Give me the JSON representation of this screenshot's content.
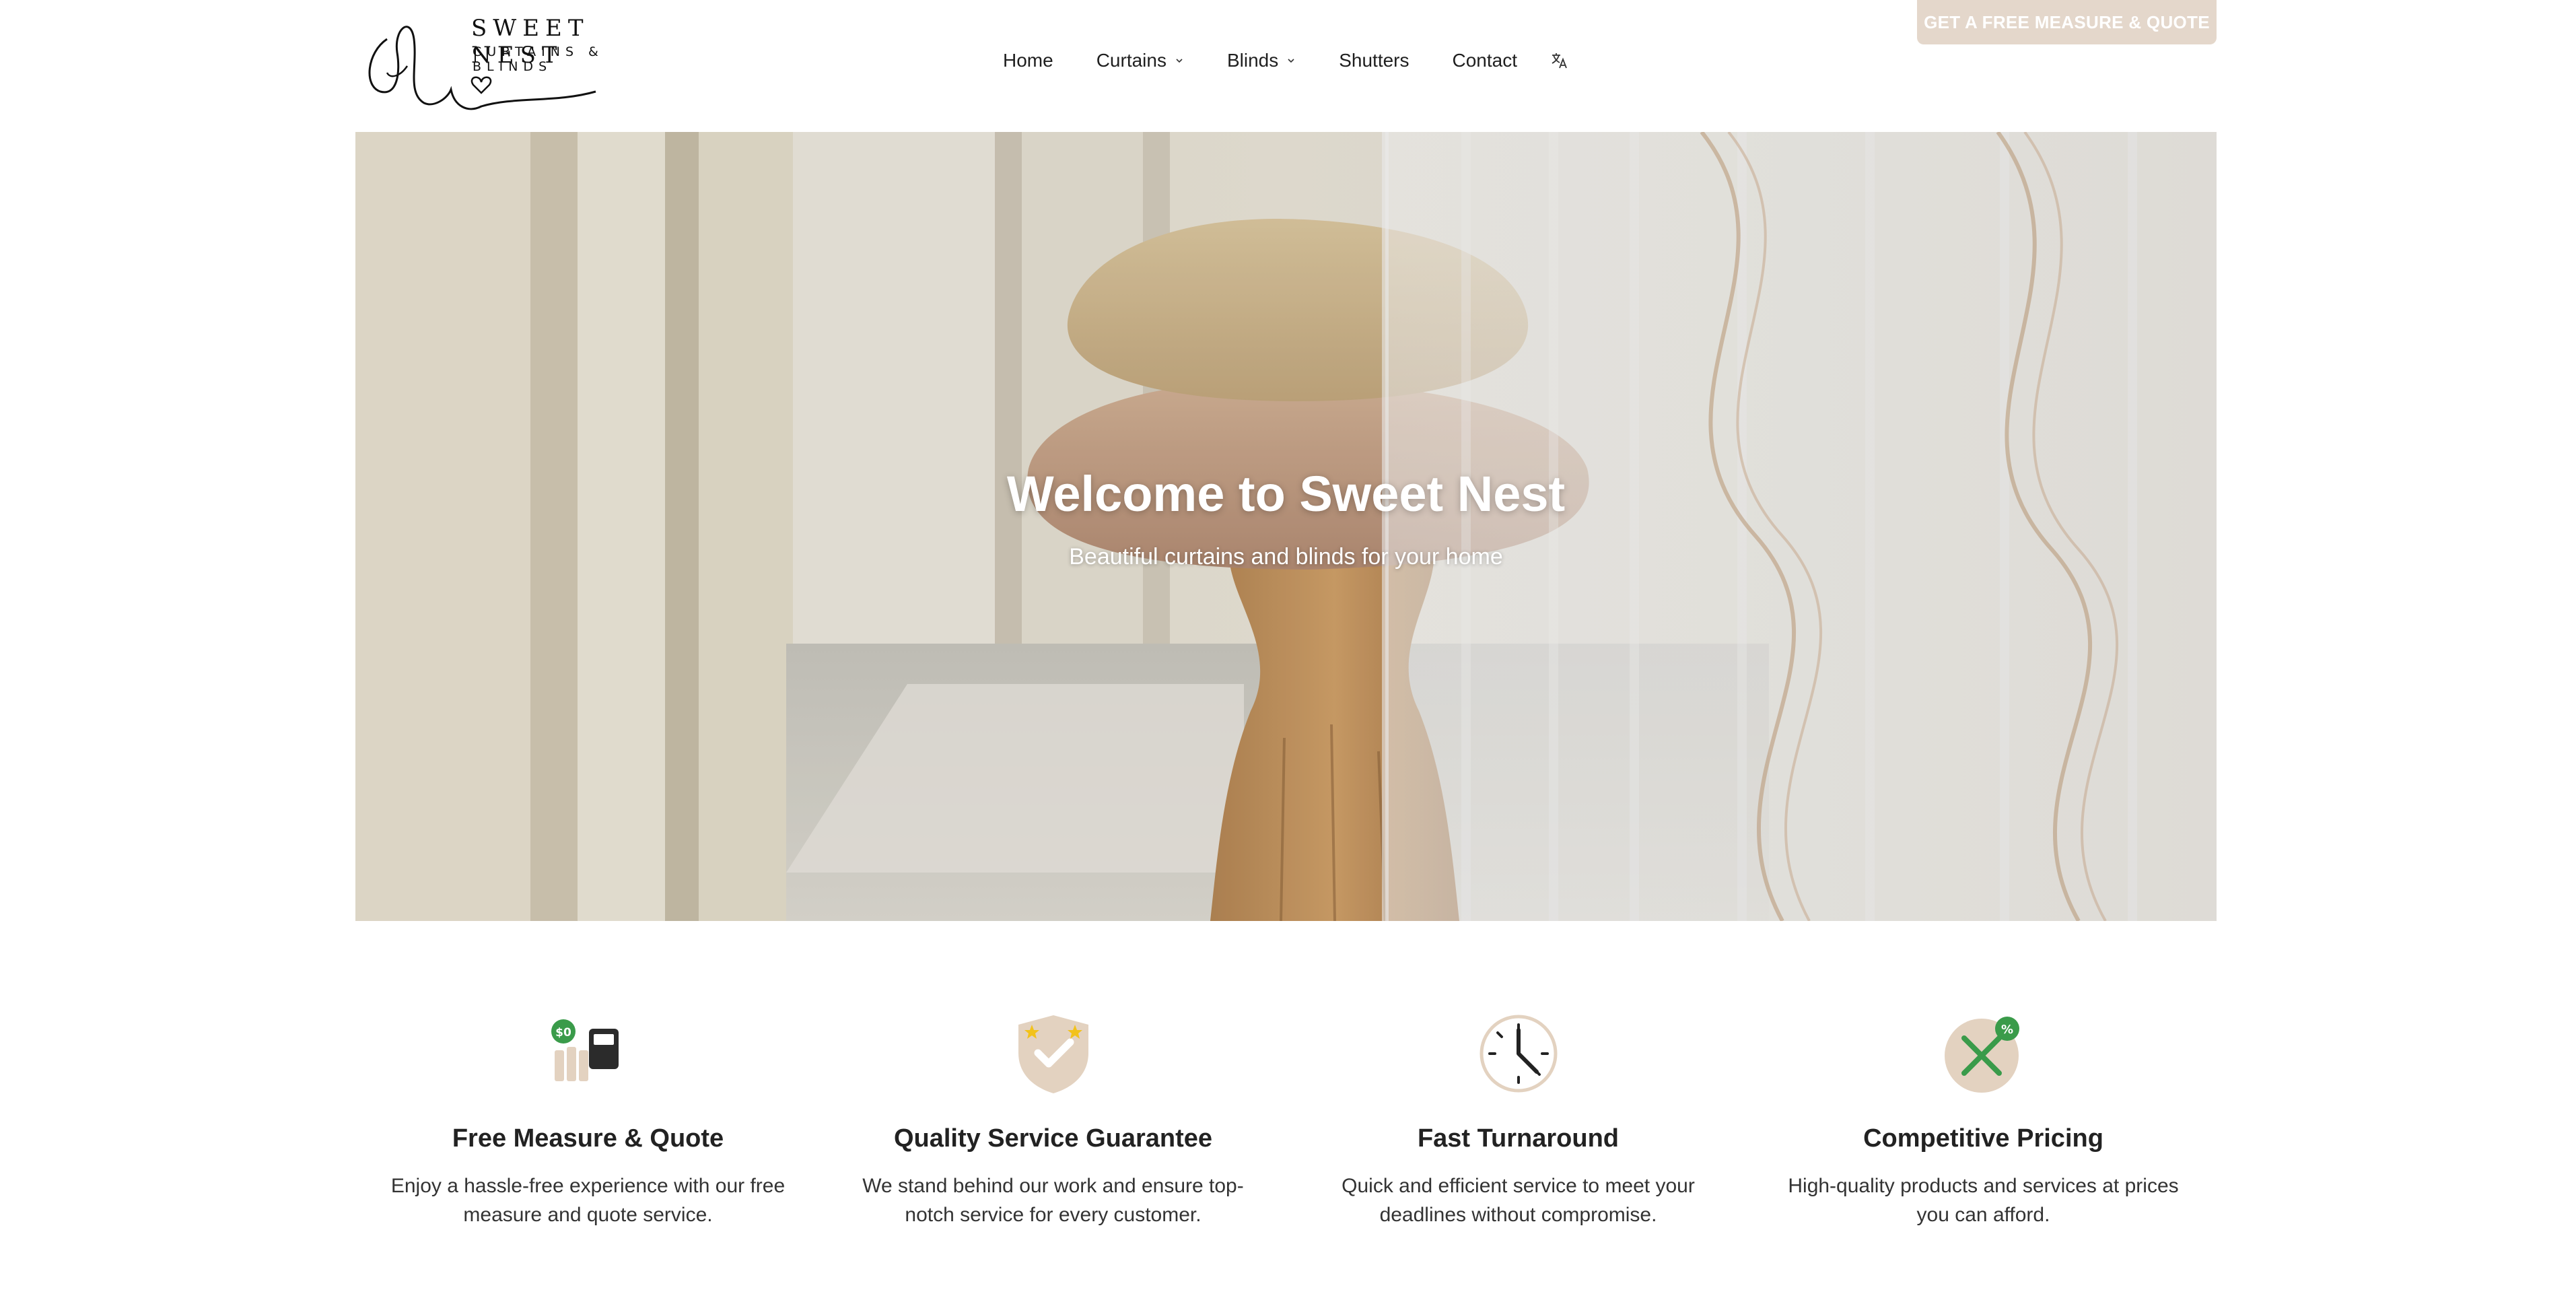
{
  "logo": {
    "name": "SWEET NEST",
    "tagline": "CURTAINS & BLINDS"
  },
  "nav": {
    "items": [
      {
        "label": "Home",
        "dropdown": false
      },
      {
        "label": "Curtains",
        "dropdown": true
      },
      {
        "label": "Blinds",
        "dropdown": true
      },
      {
        "label": "Shutters",
        "dropdown": false
      },
      {
        "label": "Contact",
        "dropdown": false
      }
    ],
    "translate_icon": "translate-icon"
  },
  "cta": {
    "label": "GET A FREE MEASURE & QUOTE"
  },
  "hero": {
    "title": "Welcome to Sweet Nest",
    "subtitle": "Beautiful curtains and blinds for your home"
  },
  "features": [
    {
      "icon": "calculator-coins-icon",
      "title": "Free Measure & Quote",
      "text": "Enjoy a hassle-free experience with our free measure and quote service."
    },
    {
      "icon": "shield-check-icon",
      "title": "Quality Service Guarantee",
      "text": "We stand behind our work and ensure top-notch service for every customer."
    },
    {
      "icon": "clock-icon",
      "title": "Fast Turnaround",
      "text": "Quick and efficient service to meet your deadlines without compromise."
    },
    {
      "icon": "discount-tag-icon",
      "title": "Competitive Pricing",
      "text": "High-quality products and services at prices you can afford."
    }
  ],
  "colors": {
    "cta_bg": "#e4d7cb",
    "icon_beige": "#e3d2c0",
    "icon_green": "#3a9b4a",
    "text": "#1f1f1f"
  }
}
